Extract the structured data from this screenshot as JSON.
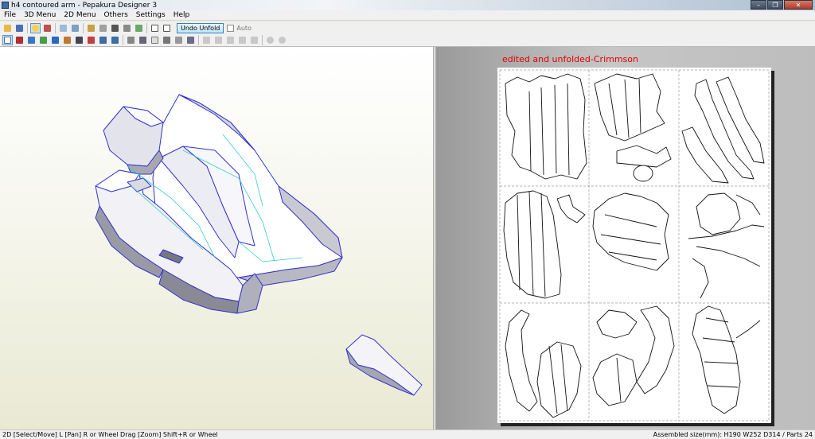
{
  "window": {
    "title": "h4 contoured arm - Pepakura Designer 3"
  },
  "menu": [
    "File",
    "3D Menu",
    "2D Menu",
    "Others",
    "Settings",
    "Help"
  ],
  "toolbar": {
    "undo_unfold_label": "Undo Unfold",
    "auto_label": "Auto"
  },
  "view2d": {
    "caption": "edited and unfolded-Crimmson"
  },
  "status": {
    "left": "2D [Select/Move] L [Pan] R or Wheel Drag [Zoom] Shift+R or Wheel",
    "right": "Assembled size(mm): H190 W252 D314 / Parts 24"
  },
  "colors": {
    "caption": "#e00000",
    "edge_blue": "#3333cc",
    "fold_cyan": "#33cccc"
  }
}
